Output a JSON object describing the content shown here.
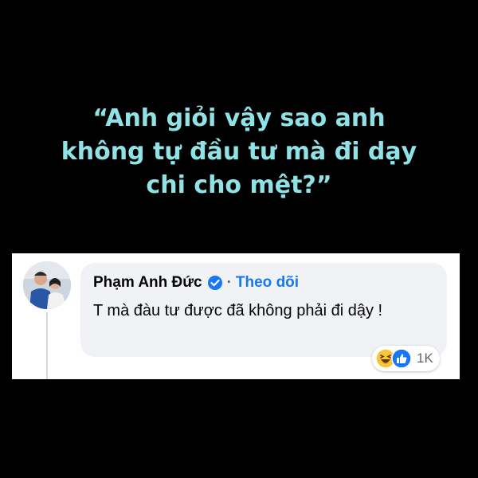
{
  "quote": {
    "lines": [
      "“Anh giỏi vậy sao anh",
      "không tự đầu tư mà đi dạy",
      "chi cho mệt?”"
    ]
  },
  "comment": {
    "author": "Phạm Anh Đức",
    "separator": "·",
    "follow_label": "Theo dõi",
    "text": "T mà đàu tư được đã không phải đi dậy !",
    "reaction_count": "1K",
    "reaction_icons": [
      "haha-icon",
      "like-icon"
    ]
  },
  "colors": {
    "background": "#000000",
    "quote_text": "#8fe3e6",
    "follow_link": "#1877f2",
    "bubble": "#f0f2f5"
  }
}
